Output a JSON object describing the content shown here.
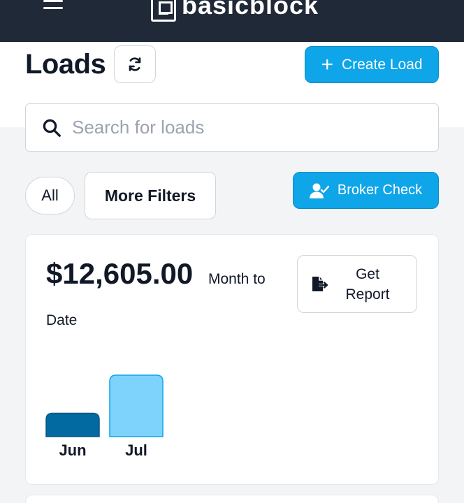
{
  "app": {
    "brand": "basicblock"
  },
  "header": {
    "title": "Loads",
    "create_label": "Create Load",
    "refresh_icon": "refresh-icon"
  },
  "search": {
    "placeholder": "Search for loads",
    "value": ""
  },
  "filters": {
    "all_label": "All",
    "more_label": "More Filters",
    "broker_label": "Broker Check"
  },
  "summary": {
    "amount": "$12,605.00",
    "period_line1": "Month to",
    "period_line2": "Date",
    "report_line1": "Get",
    "report_line2": "Report"
  },
  "colors": {
    "accent": "#0ea5e9",
    "topbar": "#1f2937",
    "bar_previous": "#0369a1",
    "bar_current": "#7dd3fc"
  },
  "chart_data": {
    "type": "bar",
    "categories": [
      "Jun",
      "Jul"
    ],
    "values": [
      3.8,
      10
    ],
    "title": "",
    "xlabel": "",
    "ylabel": ""
  }
}
